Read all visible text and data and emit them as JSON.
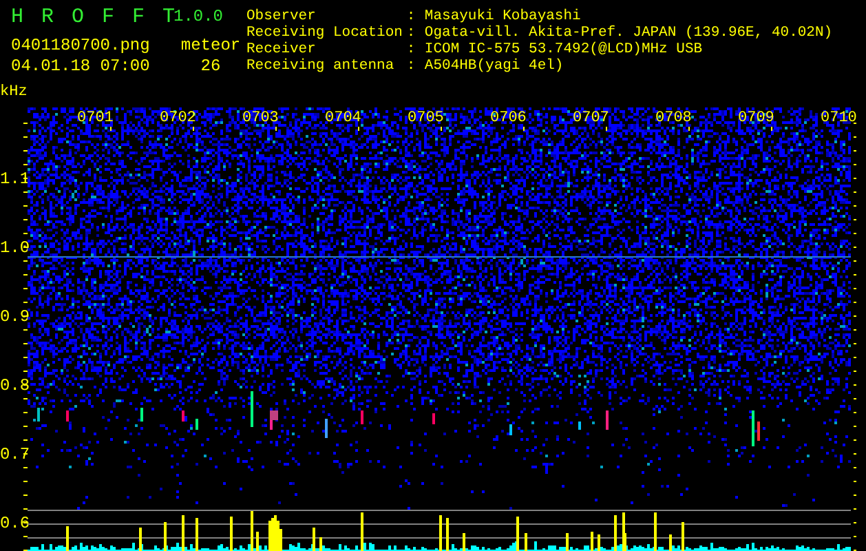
{
  "app": {
    "name": "H R O F F T",
    "version": "1.0.0"
  },
  "file": {
    "filename": "0401180700.png",
    "datetime": "04.01.18 07:00"
  },
  "meteor": {
    "label": "meteor",
    "count": "26"
  },
  "station_info": [
    {
      "label": "Observer",
      "separator": ":",
      "value": "Masayuki Kobayashi"
    },
    {
      "label": "Receiving Location",
      "separator": ":",
      "value": "Ogata-vill. Akita-Pref. JAPAN (139.96E, 40.02N)"
    },
    {
      "label": "Receiver",
      "separator": ":",
      "value": "ICOM IC-575 53.7492(@LCD)MHz USB"
    },
    {
      "label": "Receiving antenna",
      "separator": ":",
      "value": "A504HB(yagi 4el)"
    }
  ],
  "spectrogram": {
    "unit": "kHz",
    "frequency_labels": [
      "1.1",
      "1.0",
      "0.9",
      "0.8",
      "0.7",
      "0.6"
    ],
    "time_labels": [
      "0701",
      "0702",
      "0703",
      "0704",
      "0705",
      "0706",
      "0707",
      "0708",
      "0709",
      "0710"
    ]
  }
}
